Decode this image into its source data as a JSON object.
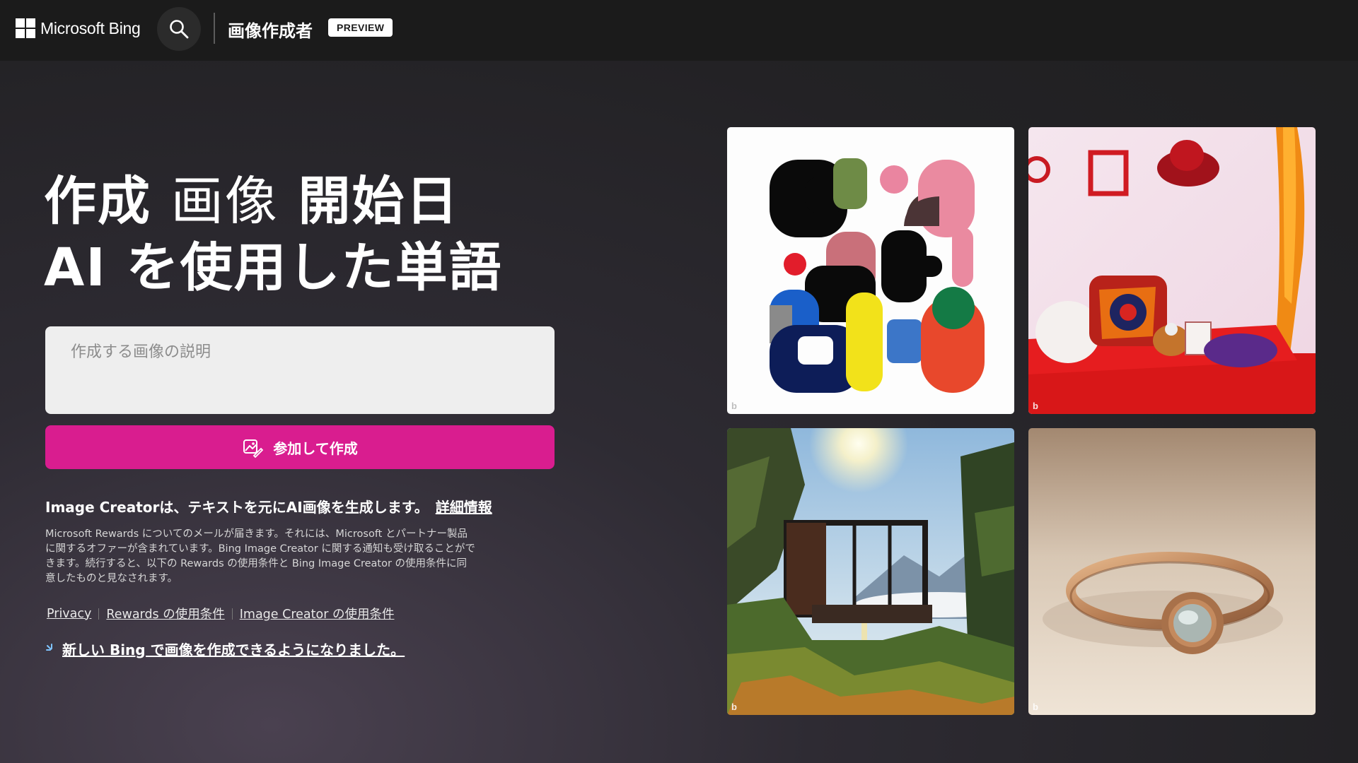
{
  "header": {
    "brand": "Microsoft Bing",
    "search_icon": "search-icon",
    "app_title": "画像作成者",
    "badge": "PREVIEW"
  },
  "hero": {
    "line1_a": "作成",
    "line1_b": "画像",
    "line1_c": "開始日",
    "line2": "AI を使用した単語"
  },
  "prompt": {
    "placeholder": "作成する画像の説明"
  },
  "create_button": {
    "label": "参加して作成",
    "icon": "image-create-icon"
  },
  "info": {
    "text": "Image Creatorは、テキストを元にAI画像を生成します。",
    "link": "詳細情報"
  },
  "disclaimer": "Microsoft Rewards についてのメールが届きます。それには、Microsoft とパートナー製品に関するオファーが含まれています。Bing Image Creator に関する通知も受け取ることができます。続行すると、以下の Rewards の使用条件と Bing Image Creator の使用条件に同意したものと見なされます。",
  "legal": {
    "privacy": "Privacy",
    "rewards_terms": "Rewards の使用条件",
    "creator_terms": "Image Creator の使用条件"
  },
  "announcement": {
    "icon": "sparkle-icon",
    "text": "新しい Bing で画像を作成できるようになりました。"
  },
  "gallery": {
    "mark": "b",
    "colors": {
      "accent": "#d91d8f",
      "header_bg": "#1b1b1b"
    }
  }
}
